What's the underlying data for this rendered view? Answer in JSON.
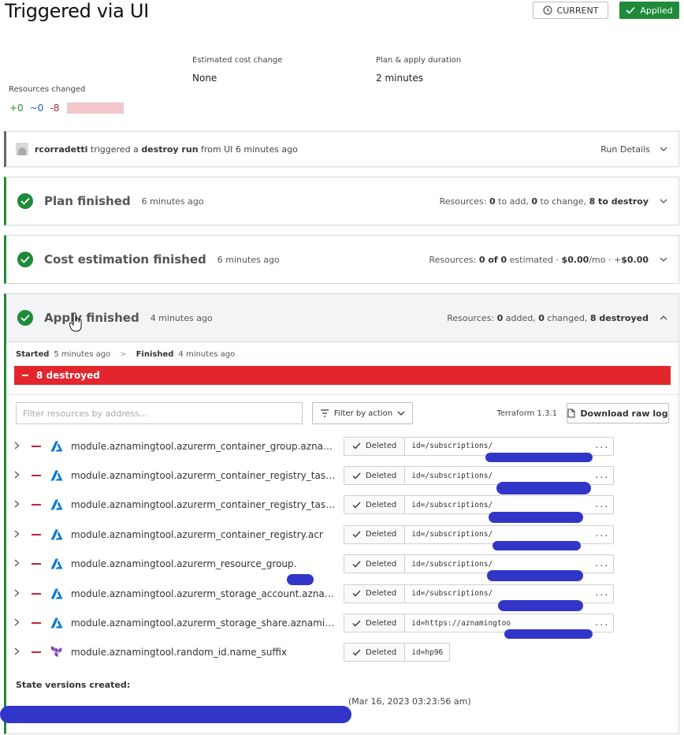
{
  "page": {
    "title": "Triggered via UI",
    "current_label": "CURRENT",
    "applied_label": "Applied"
  },
  "summary": {
    "cost_label": "Estimated cost change",
    "cost_value": "None",
    "duration_label": "Plan & apply duration",
    "duration_value": "2 minutes",
    "resources_label": "Resources changed",
    "add": "+0",
    "change": "~0",
    "destroy": "-8"
  },
  "trigger": {
    "user": "rcorradetti",
    "text1": "triggered a",
    "run_type": "destroy run",
    "text2": "from UI 6 minutes ago",
    "details_label": "Run Details"
  },
  "plan": {
    "title": "Plan finished",
    "time": "6 minutes ago",
    "resources_prefix": "Resources:",
    "add": "0",
    "add_label": "to add,",
    "change": "0",
    "change_label": "to change,",
    "destroy": "8 to destroy"
  },
  "cost": {
    "title": "Cost estimation finished",
    "time": "6 minutes ago",
    "resources_prefix": "Resources:",
    "count": "0 of 0",
    "estimated_label": "estimated ·",
    "monthly": "$0.00",
    "monthly_suffix": "/mo · +",
    "delta": "$0.00"
  },
  "apply": {
    "title": "Apply finished",
    "time": "4 minutes ago",
    "resources_prefix": "Resources:",
    "added": "0",
    "added_label": "added,",
    "changed": "0",
    "changed_label": "changed,",
    "destroyed": "8 destroyed",
    "started_label": "Started",
    "started_time": "5 minutes ago",
    "arrow": ">",
    "finished_label": "Finished",
    "finished_time": "4 minutes ago",
    "destroy_banner": "8 destroyed"
  },
  "toolbar": {
    "filter_placeholder": "Filter resources by address...",
    "filter_action_label": "Filter by action",
    "terraform_version": "Terraform 1.3.1",
    "download_label": "Download raw log"
  },
  "resources": [
    {
      "address": "module.aznamingtool.azurerm_container_group.aznamingtool",
      "status": "Deleted",
      "id": "id=/subscriptions/",
      "provider": "azure"
    },
    {
      "address": "module.aznamingtool.azurerm_container_registry_task_schedule",
      "status": "Deleted",
      "id": "id=/subscriptions/",
      "provider": "azure"
    },
    {
      "address": "module.aznamingtool.azurerm_container_registry_task.acr",
      "status": "Deleted",
      "id": "id=/subscriptions/",
      "provider": "azure"
    },
    {
      "address": "module.aznamingtool.azurerm_container_registry.acr",
      "status": "Deleted",
      "id": "id=/subscriptions/",
      "provider": "azure"
    },
    {
      "address": "module.aznamingtool.azurerm_resource_group.",
      "status": "Deleted",
      "id": "id=/subscriptions/",
      "provider": "azure"
    },
    {
      "address": "module.aznamingtool.azurerm_storage_account.aznamingtool",
      "status": "Deleted",
      "id": "id=/subscriptions/",
      "provider": "azure"
    },
    {
      "address": "module.aznamingtool.azurerm_storage_share.aznamingtool",
      "status": "Deleted",
      "id": "id=https://aznamingtoo",
      "provider": "azure"
    },
    {
      "address": "module.aznamingtool.random_id.name_suffix",
      "status": "Deleted",
      "id": "id=hp96",
      "provider": "terraform"
    }
  ],
  "ellipsis": "...",
  "state": {
    "title": "State versions created:",
    "timestamp": "(Mar 16, 2023 03:23:56 am)"
  },
  "colors": {
    "success": "#1f8a3a",
    "destroy": "#e3262d",
    "azure": "#0a78d4",
    "terraform": "#7b42bc",
    "redaction": "#3236c8"
  }
}
